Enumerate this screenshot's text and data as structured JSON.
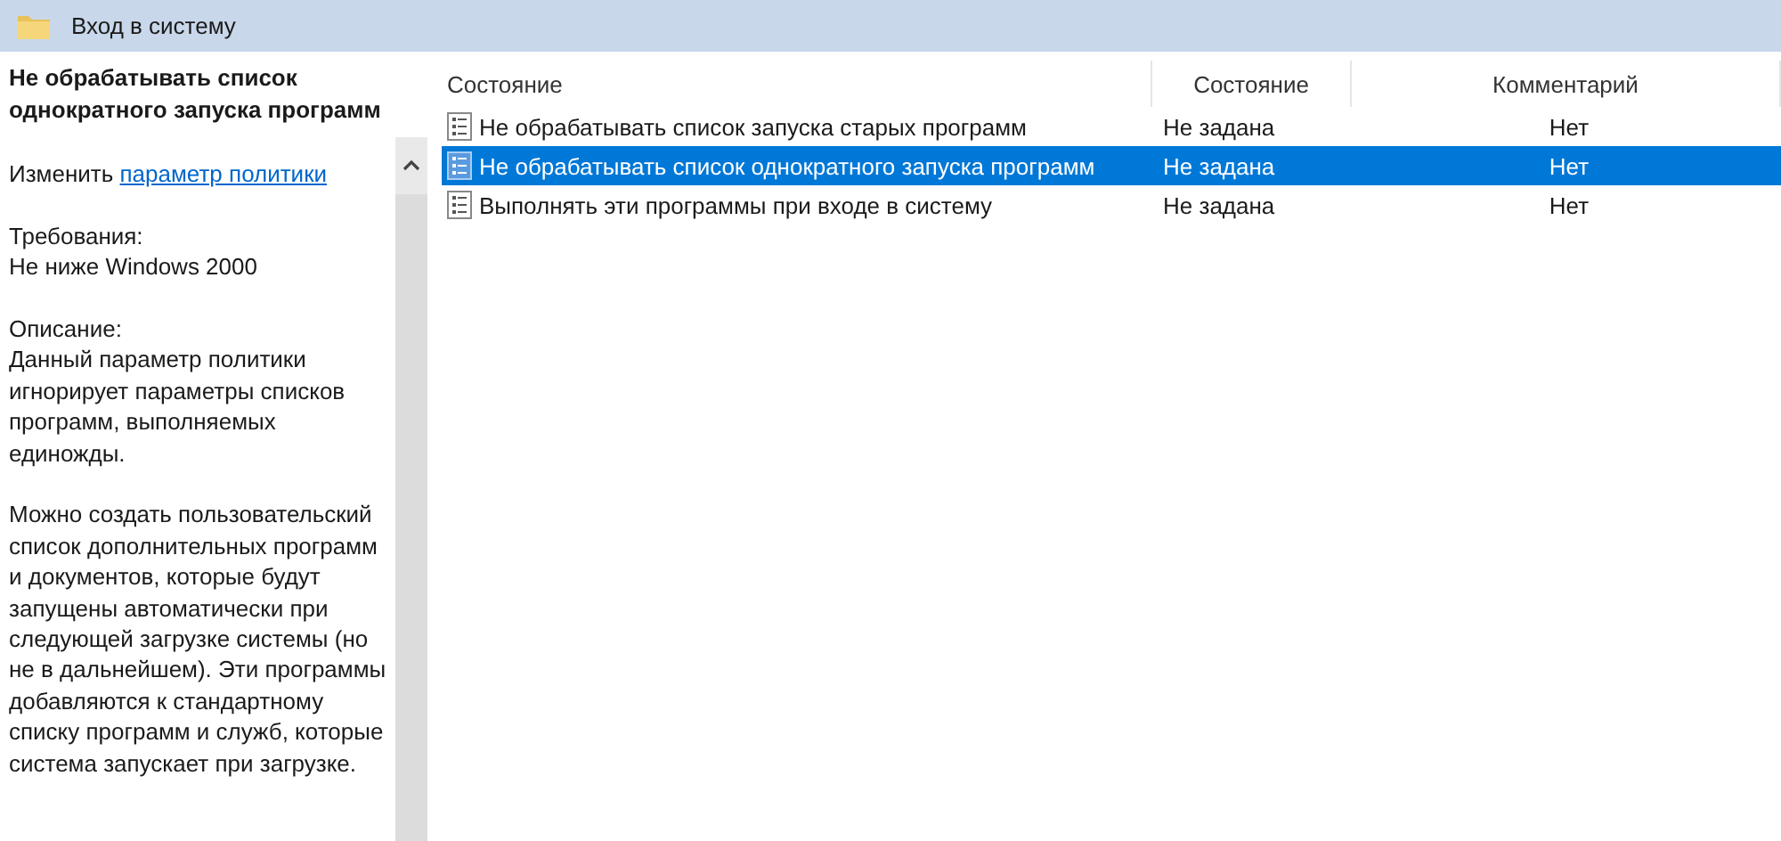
{
  "window": {
    "title": "Вход в систему"
  },
  "description_pane": {
    "heading": "Не обрабатывать список однократного запуска программ",
    "edit_prefix": "Изменить",
    "edit_link": "параметр политики",
    "requirements_label": "Требования:",
    "requirements": "Не ниже Windows 2000",
    "description_label": "Описание:",
    "paragraphs": [
      "Данный параметр политики игнорирует параметры списков программ, выполняемых единожды.",
      "Можно создать пользовательский список дополнительных программ и документов, которые будут запущены автоматически при следующей загрузке системы (но не в дальнейшем). Эти программы добавляются к стандартному списку программ и служб, которые система запускает при загрузке."
    ]
  },
  "table": {
    "columns": [
      "Состояние",
      "Состояние",
      "Комментарий"
    ],
    "rows": [
      {
        "name": "Не обрабатывать список запуска старых программ",
        "state": "Не задана",
        "comment": "Нет",
        "selected": false
      },
      {
        "name": "Не обрабатывать список однократного запуска программ",
        "state": "Не задана",
        "comment": "Нет",
        "selected": true
      },
      {
        "name": "Выполнять эти программы при входе в систему",
        "state": "Не задана",
        "comment": "Нет",
        "selected": false
      }
    ]
  }
}
